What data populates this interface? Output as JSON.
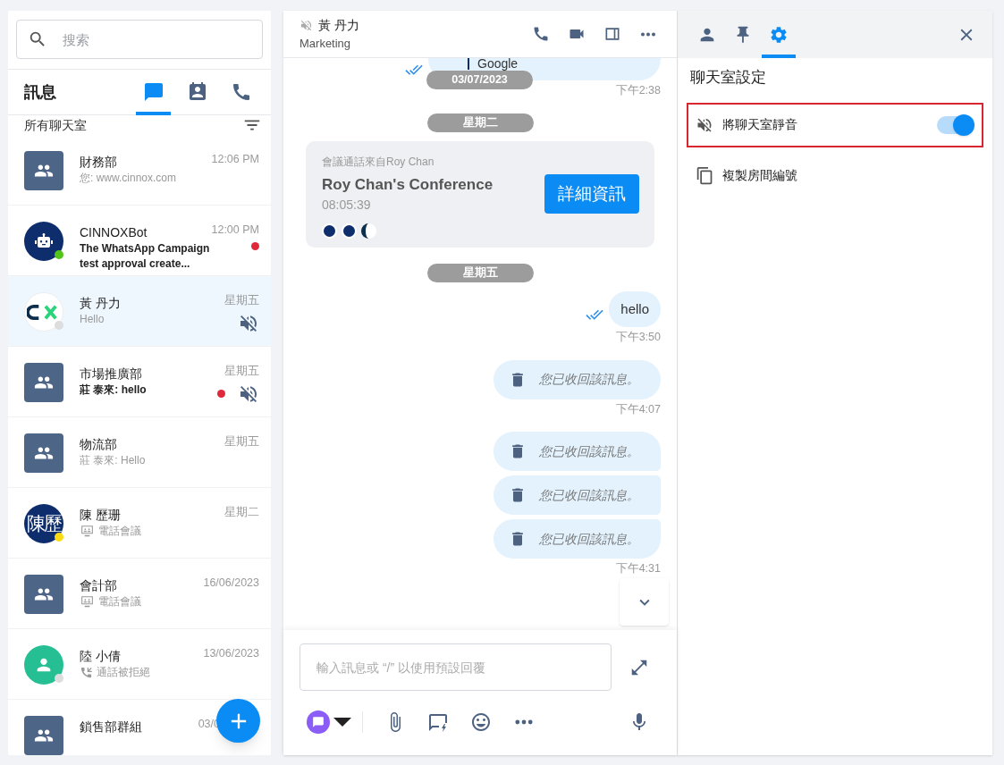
{
  "sidebar": {
    "search": {
      "placeholder": "搜索"
    },
    "title": "訊息",
    "tabs": [
      {
        "kind": "chat",
        "selected": true
      },
      {
        "kind": "contacts",
        "selected": false
      },
      {
        "kind": "phone",
        "selected": false
      }
    ],
    "filter_label": "所有聊天室",
    "conversations": [
      {
        "kind": "group",
        "name": "財務部",
        "preview": {
          "kind": "text",
          "text": "您: www.cinnox.com"
        },
        "time": "12:06 PM",
        "unread": false,
        "muted": false,
        "selected": false
      },
      {
        "kind": "bot",
        "name": "CINNOXBot",
        "preview": {
          "kind": "text",
          "text": "The WhatsApp Campaign test approval create..."
        },
        "time": "12:00 PM",
        "color": "#52c41a",
        "unread": true,
        "muted": false,
        "selected": false
      },
      {
        "kind": "logo",
        "name": "黃 丹力",
        "preview": {
          "kind": "text",
          "text": "Hello"
        },
        "time": "星期五",
        "color": "#dddddd",
        "unread": false,
        "muted": true,
        "selected": true
      },
      {
        "kind": "group",
        "name": "市場推廣部",
        "preview": {
          "kind": "text",
          "text": "莊 泰來: hello"
        },
        "time": "星期五",
        "unread": true,
        "muted": true,
        "selected": false
      },
      {
        "kind": "group",
        "name": "物流部",
        "preview": {
          "kind": "text",
          "text": "莊 泰來: Hello"
        },
        "time": "星期五",
        "unread": false,
        "muted": false,
        "selected": false
      },
      {
        "kind": "initials",
        "initials": "陳歷",
        "name": "陳 歷珊",
        "preview": {
          "kind": "conference",
          "text": "電話會議"
        },
        "time": "星期二",
        "color": "#fadb14",
        "unread": false,
        "muted": false,
        "selected": false
      },
      {
        "kind": "group",
        "name": "會計部",
        "preview": {
          "kind": "conference",
          "text": "電話會議"
        },
        "time": "16/06/2023",
        "unread": false,
        "muted": false,
        "selected": false
      },
      {
        "kind": "person",
        "name": "陸 小倩",
        "preview": {
          "kind": "call-rejected",
          "text": "通話被拒絕"
        },
        "time": "13/06/2023",
        "color": "#dddddd",
        "unread": false,
        "muted": false,
        "selected": false
      },
      {
        "kind": "group",
        "name": "鎖售部群組",
        "time": "03/0",
        "unread": false,
        "muted": false,
        "selected": false
      }
    ]
  },
  "chat": {
    "muted": true,
    "name": "黃 丹力",
    "subtitle": "Marketing",
    "sticky_date": "03/07/2023",
    "messages": [
      {
        "kind": "partial",
        "text": "Google",
        "read": true
      },
      {
        "kind": "time",
        "text": "下午2:38"
      },
      {
        "kind": "date",
        "text": "星期二"
      },
      {
        "kind": "conference",
        "caption": "會議通話來自Roy Chan",
        "title": "Roy Chan's Conference",
        "duration": "08:05:39",
        "button": "詳細資訊",
        "participants": [
          {
            "kind": "avatar"
          },
          {
            "kind": "avatar"
          },
          {
            "kind": "logo"
          }
        ]
      },
      {
        "kind": "date",
        "text": "星期五"
      },
      {
        "kind": "text",
        "text": "hello",
        "read": true
      },
      {
        "kind": "time",
        "text": "下午3:50"
      },
      {
        "kind": "recalled",
        "text": "您已收回該訊息。"
      },
      {
        "kind": "time",
        "text": "下午4:07"
      },
      {
        "kind": "recalled",
        "text": "您已收回該訊息。"
      },
      {
        "kind": "recalled",
        "text": "您已收回該訊息。"
      },
      {
        "kind": "recalled",
        "text": "您已收回該訊息。"
      },
      {
        "kind": "time",
        "text": "下午4:31"
      }
    ],
    "composer": {
      "placeholder": "輸入訊息或 “/” 以使用預設回覆"
    }
  },
  "settings": {
    "tabs": [
      {
        "kind": "person",
        "selected": false
      },
      {
        "kind": "pin",
        "selected": false
      },
      {
        "kind": "gear",
        "selected": true
      }
    ],
    "title": "聊天室設定",
    "rows": [
      {
        "kind": "toggle",
        "label": "將聊天室靜音",
        "on": true,
        "highlighted": true
      },
      {
        "kind": "action",
        "label": "複製房間編號",
        "highlighted": false
      }
    ]
  }
}
